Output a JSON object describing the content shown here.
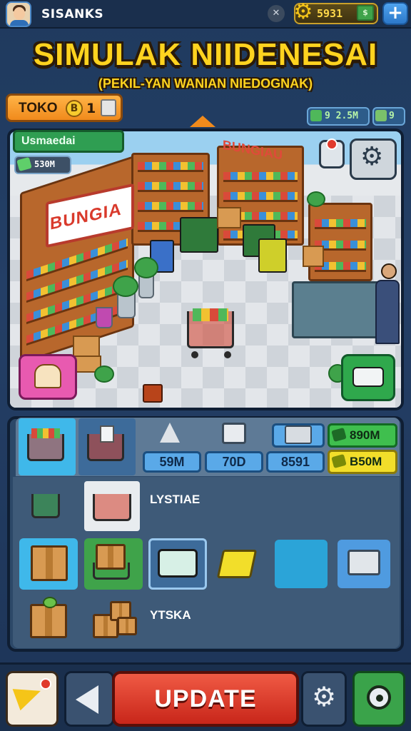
{
  "header": {
    "player_name": "SISANKS",
    "currency_value": "5931",
    "icons": {
      "avatar": "player-avatar",
      "close": "x-icon",
      "currency": "gear-coin-icon",
      "cash": "cash-icon",
      "add": "plus-icon"
    },
    "add_symbol": "+",
    "close_symbol": "✕"
  },
  "title": {
    "main": "SIMULAK NIIDENESAI",
    "subtitle": "(PEKIL-YAN WANIAN NIEDOGNAK)"
  },
  "store_tag": {
    "label": "TOKO",
    "level_coin": "B",
    "level": "1"
  },
  "mini_stats": {
    "stat_a": "9 2.5M",
    "stat_b": "9"
  },
  "scene": {
    "label": "Usmaedai",
    "money": "530M",
    "front_sign": "BUNGIA",
    "back_sign": "BUNGIAU"
  },
  "inventory": {
    "stat_boxes": [
      "59M",
      "70D",
      "8591"
    ],
    "money_boxes": [
      "890M",
      "B50M"
    ],
    "item_labels": [
      "LYSTIAE",
      "YTSKA"
    ]
  },
  "bottom_bar": {
    "update_label": "UPDATE",
    "icons": {
      "alert": "megaphone-icon",
      "back": "back-arrow-icon",
      "settings": "gear-icon",
      "camera": "camera-icon"
    }
  },
  "colors": {
    "accent_gold": "#ffd31f",
    "update_red": "#e0402e",
    "panel_blue": "#2c4868",
    "positive_green": "#3fbf4e"
  }
}
